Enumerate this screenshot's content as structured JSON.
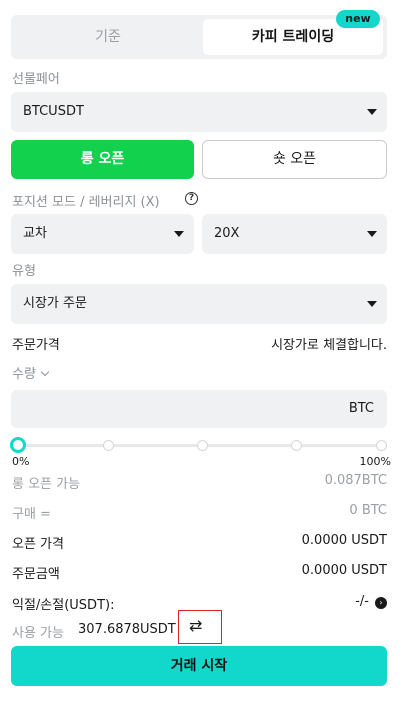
{
  "tabs": {
    "standard": "기준",
    "copy": "카피 트레이딩",
    "badge": "new"
  },
  "pair": {
    "label": "선물페어",
    "value": "BTCUSDT"
  },
  "side": {
    "long": "롱 오픈",
    "short": "숏 오픈"
  },
  "position": {
    "label": "포지션 모드 / 레버리지 (X)",
    "help": "?",
    "mode": "교차",
    "leverage": "20X"
  },
  "order_type": {
    "label": "유형",
    "value": "시장가 주문"
  },
  "order_price": {
    "label": "주문가격",
    "value": "시장가로 체결합니다."
  },
  "quantity": {
    "label": "수량",
    "unit": "BTC",
    "value_percent": 0
  },
  "slider": {
    "min_label": "0%",
    "max_label": "100%"
  },
  "info": {
    "long_available_label": "롱 오픈 가능",
    "long_available_value": "0.087BTC",
    "buy_label": "구매 =",
    "buy_value": "0 BTC",
    "open_price_label": "오픈 가격",
    "open_price_value": "0.0000 USDT",
    "order_amount_label": "주문금액",
    "order_amount_value": "0.0000 USDT",
    "pnl_label": "익절/손절(USDT):",
    "pnl_value": "-/-"
  },
  "available": {
    "label": "사용 가능",
    "value": "307.6878USDT",
    "swap_icon": "⇄"
  },
  "start_button": "거래 시작",
  "colors": {
    "accent": "#12d8cc",
    "long": "#11d14d",
    "highlight_box": "#d9262a"
  }
}
